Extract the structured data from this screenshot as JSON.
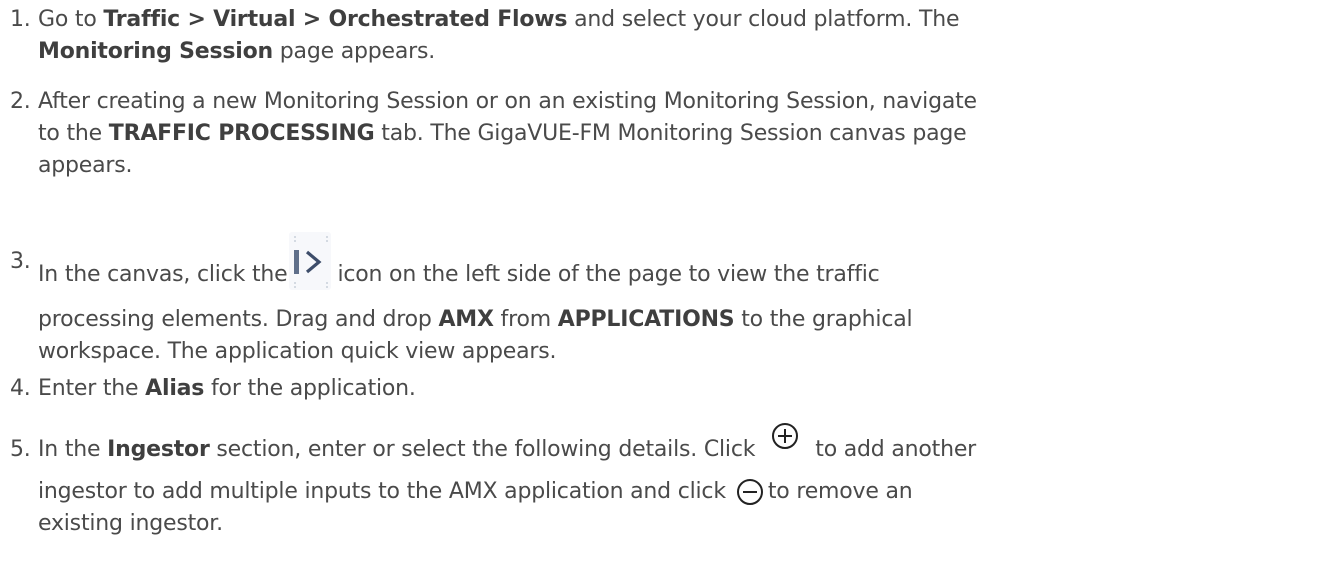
{
  "steps": [
    {
      "number": "1.",
      "parts": {
        "a": "Go to ",
        "b": "Traffic > Virtual > Orchestrated Flows",
        "c": " and select your cloud platform. The",
        "d": "Monitoring Session",
        "e": " page appears."
      }
    },
    {
      "number": "2.",
      "parts": {
        "a": "After creating a new Monitoring Session or on an existing Monitoring Session, navigate",
        "b": "to the ",
        "c": "TRAFFIC PROCESSING",
        "d": " tab. The GigaVUE-FM Monitoring Session canvas page",
        "e": "appears."
      }
    },
    {
      "number": "3.",
      "parts": {
        "a": "In the canvas, click the",
        "icon": "expand-panel-icon",
        "b": "icon on the left side of the page to view the traffic",
        "c": "processing elements. Drag and drop ",
        "d": "AMX",
        "e": " from ",
        "f": "APPLICATIONS",
        "g": " to the graphical",
        "h": "workspace. The application quick view appears."
      }
    },
    {
      "number": "4.",
      "parts": {
        "a": "Enter the ",
        "b": "Alias",
        "c": " for the application."
      }
    },
    {
      "number": "5.",
      "parts": {
        "a": " In the ",
        "b": "Ingestor",
        "c": " section, enter or select the following details. Click",
        "add_icon": "add-circle-icon",
        "d": "to add another",
        "e": "ingestor to add multiple inputs to the AMX application and click",
        "remove_icon": "remove-circle-icon",
        "f": "to remove an",
        "g": "existing ingestor."
      }
    }
  ],
  "colors": {
    "text": "#4a4a4a",
    "icon_bar": "#5f6f8a",
    "icon_arrow": "#3d4d6a"
  }
}
